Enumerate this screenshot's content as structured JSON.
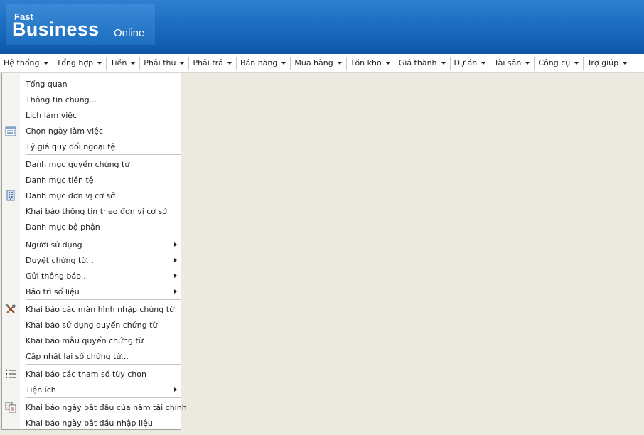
{
  "header": {
    "logo_fast": "Fast",
    "logo_business": "Business",
    "logo_online": "Online"
  },
  "menubar": {
    "items": [
      {
        "label": "Hệ thống"
      },
      {
        "label": "Tổng hợp"
      },
      {
        "label": "Tiền"
      },
      {
        "label": "Phải thu"
      },
      {
        "label": "Phải trả"
      },
      {
        "label": "Bán hàng"
      },
      {
        "label": "Mua hàng"
      },
      {
        "label": "Tồn kho"
      },
      {
        "label": "Giá thành"
      },
      {
        "label": "Dự án"
      },
      {
        "label": "Tài sản"
      },
      {
        "label": "Công cụ"
      },
      {
        "label": "Trợ giúp"
      }
    ]
  },
  "dropdown": {
    "items": [
      {
        "label": "Tổng quan"
      },
      {
        "label": "Thông tin chung..."
      },
      {
        "label": "Lịch làm việc"
      },
      {
        "label": "Chọn ngày làm việc",
        "icon": "calendar-icon"
      },
      {
        "label": "Tỷ giá quy đổi ngoại tệ"
      },
      {
        "label": "Danh mục quyển chứng từ"
      },
      {
        "label": "Danh mục tiền tệ"
      },
      {
        "label": "Danh mục đơn vị cơ sở",
        "icon": "building-icon"
      },
      {
        "label": "Khai báo thông tin theo đơn vị cơ sở"
      },
      {
        "label": "Danh mục bộ phận"
      },
      {
        "label": "Người sử dụng",
        "submenu": true
      },
      {
        "label": "Duyệt chứng từ...",
        "submenu": true
      },
      {
        "label": "Gửi thông báo...",
        "submenu": true
      },
      {
        "label": "Bảo trì số liệu",
        "submenu": true
      },
      {
        "label": "Khai báo các màn hình nhập chứng từ",
        "icon": "tools-icon"
      },
      {
        "label": "Khai báo sử dụng quyển chứng từ"
      },
      {
        "label": "Khai báo mẫu quyển chứng từ"
      },
      {
        "label": "Cập nhật lại số chứng từ..."
      },
      {
        "label": "Khai báo các tham số tùy chọn",
        "icon": "list-icon"
      },
      {
        "label": "Tiện ích",
        "submenu": true
      },
      {
        "label": "Khai báo ngày bắt đầu của năm tài chính",
        "icon": "copy-icon"
      },
      {
        "label": "Khai báo ngày bắt đầu nhập liệu"
      }
    ]
  }
}
